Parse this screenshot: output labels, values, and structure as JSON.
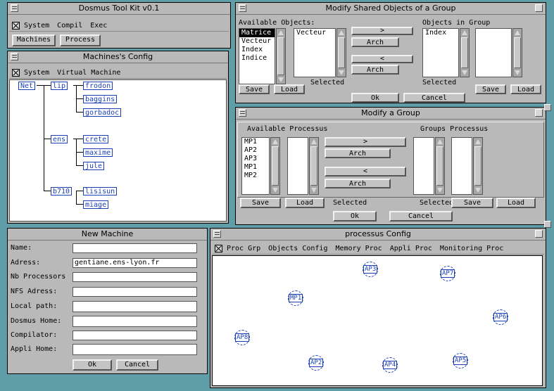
{
  "toolkit": {
    "title": "Dosmus Tool Kit v0.1",
    "menu": [
      "System",
      "Compil",
      "Exec"
    ],
    "buttons": [
      "Machines",
      "Process"
    ]
  },
  "machines_config": {
    "title": "Machines's Config",
    "menu": [
      "System",
      "Virtual Machine"
    ],
    "tree": {
      "root": "Net",
      "groups": [
        {
          "name": "lip",
          "children": [
            "frodon",
            "baggins",
            "gorbadoc"
          ]
        },
        {
          "name": "ens",
          "children": [
            "crete",
            "maxime",
            "jule"
          ]
        },
        {
          "name": "b710",
          "children": [
            "lisisun",
            "miage"
          ]
        }
      ]
    }
  },
  "new_machine": {
    "title": "New Machine",
    "fields": [
      {
        "label": "Name:",
        "value": ""
      },
      {
        "label": "Adress:",
        "value": "gentiane.ens-lyon.fr"
      },
      {
        "label": "Nb Processors",
        "value": ""
      },
      {
        "label": "NFS Adress:",
        "value": ""
      },
      {
        "label": "Local path:",
        "value": ""
      },
      {
        "label": "Dosmus Home:",
        "value": ""
      },
      {
        "label": "Compilator:",
        "value": ""
      },
      {
        "label": "Appli Home:",
        "value": ""
      }
    ],
    "ok": "Ok",
    "cancel": "Cancel"
  },
  "shared_objects": {
    "title": "Modify Shared Objects of a Group",
    "available_label": "Available Objects:",
    "available": [
      "Matrice",
      "Vecteur",
      "Index",
      "Indice"
    ],
    "selected_list": [
      "Vecteur"
    ],
    "selected_label": "Selected",
    "group_label": "Objects in Group",
    "group": [
      "Index"
    ],
    "group_selected_label": "Selected",
    "right_arrow": ">",
    "left_arrow": "<",
    "arch": "Arch",
    "save": "Save",
    "load": "Load",
    "ok": "Ok",
    "cancel": "Cancel"
  },
  "modify_group": {
    "title": "Modify a Group",
    "available_label": "Available Processus",
    "available": [
      "MP1",
      "AP2",
      "AP3",
      "MP1",
      "MP2"
    ],
    "selected_label": "Selected",
    "groups_label": "Groups Processus",
    "groups_selected_label": "Selected",
    "right_arrow": ">",
    "left_arrow": "<",
    "arch": "Arch",
    "save": "Save",
    "load": "Load",
    "ok": "Ok",
    "cancel": "Cancel"
  },
  "processus_config": {
    "title": "processus Config",
    "menu": [
      "Proc Grp",
      "Objects Config",
      "Memory Proc",
      "Appli Proc",
      "Monitoring Proc"
    ],
    "nodes": [
      "AP3",
      "AP7",
      "MP1",
      "AP6",
      "AP8",
      "AP2",
      "AP4",
      "AP5"
    ]
  }
}
